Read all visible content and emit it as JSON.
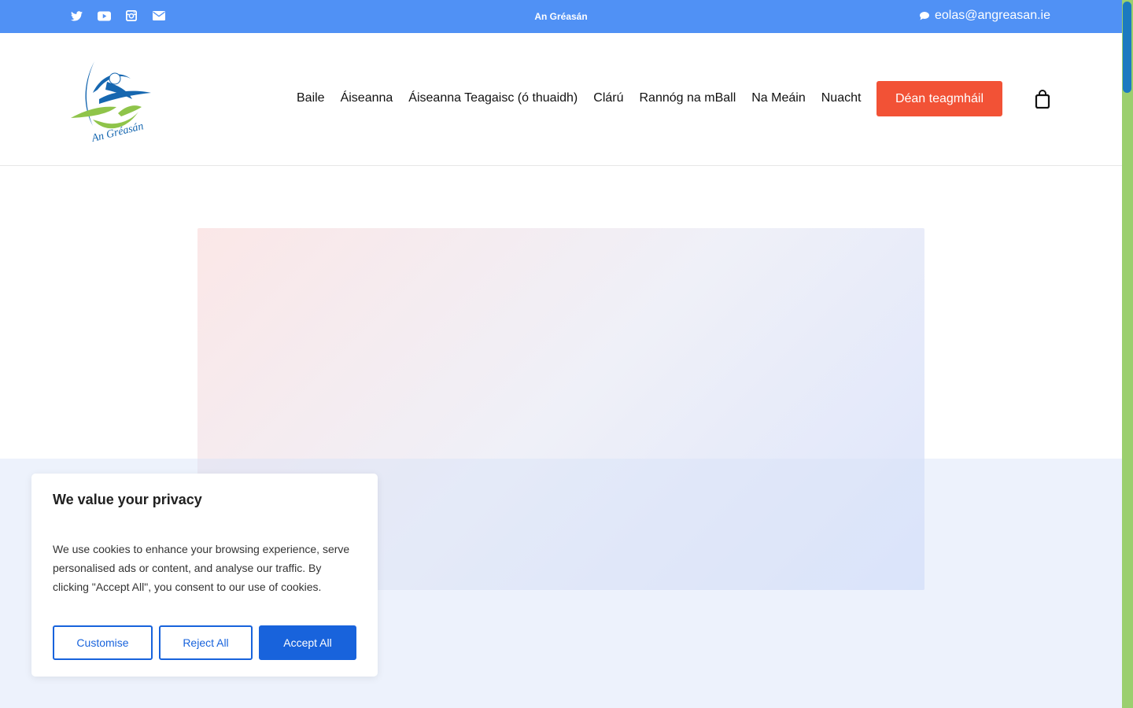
{
  "topbar": {
    "site_name": "An Gréasán",
    "email": "eolas@angreasan.ie",
    "social_icons": [
      "twitter-icon",
      "youtube-icon",
      "instagram-icon",
      "envelope-icon"
    ],
    "background": "#5091f5"
  },
  "header": {
    "logo_text": "An Gréasán",
    "nav": [
      "Baile",
      "Áiseanna",
      "Áiseanna Teagaisc (ó thuaidh)",
      "Clárú",
      "Rannóg na mBall",
      "Na Meáin",
      "Nuacht"
    ],
    "cta_label": "Déan teagmháil",
    "cta_color": "#f25236",
    "cart_icon": "shopping-bag-icon"
  },
  "cookie": {
    "title": "We value your privacy",
    "text": "We use cookies to enhance your browsing experience, serve personalised ads or content, and analyse our traffic. By clicking \"Accept All\", you consent to our use of cookies.",
    "customise_label": "Customise",
    "reject_label": "Reject All",
    "accept_label": "Accept All",
    "accent": "#1863dc"
  }
}
